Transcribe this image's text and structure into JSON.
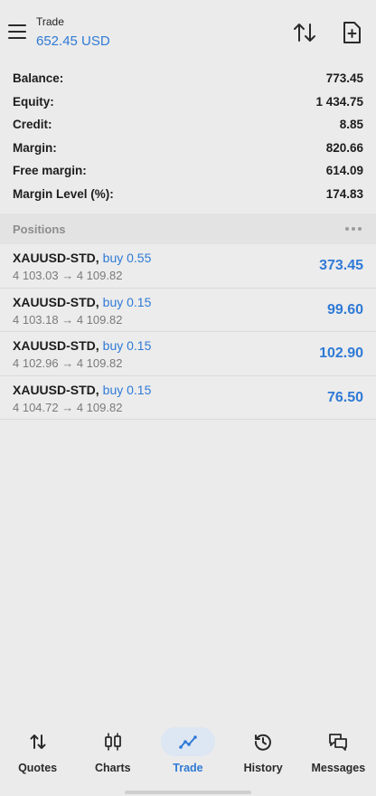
{
  "header": {
    "title": "Trade",
    "value": "652.45 USD"
  },
  "summary": [
    {
      "label": "Balance:",
      "value": "773.45"
    },
    {
      "label": "Equity:",
      "value": "1 434.75"
    },
    {
      "label": "Credit:",
      "value": "8.85"
    },
    {
      "label": "Margin:",
      "value": "820.66"
    },
    {
      "label": "Free margin:",
      "value": "614.09"
    },
    {
      "label": "Margin Level (%):",
      "value": "174.83"
    }
  ],
  "positions_section": {
    "title": "Positions"
  },
  "positions": [
    {
      "symbol": "XAUUSD-STD,",
      "side": "buy 0.55",
      "prices": "4 103.03 → 4 109.82",
      "profit": "373.45"
    },
    {
      "symbol": "XAUUSD-STD,",
      "side": "buy 0.15",
      "prices": "4 103.18 → 4 109.82",
      "profit": "99.60"
    },
    {
      "symbol": "XAUUSD-STD,",
      "side": "buy 0.15",
      "prices": "4 102.96 → 4 109.82",
      "profit": "102.90"
    },
    {
      "symbol": "XAUUSD-STD,",
      "side": "buy 0.15",
      "prices": "4 104.72 → 4 109.82",
      "profit": "76.50"
    }
  ],
  "nav": {
    "items": [
      {
        "label": "Quotes",
        "icon": "quotes-icon"
      },
      {
        "label": "Charts",
        "icon": "charts-icon"
      },
      {
        "label": "Trade",
        "icon": "trade-icon"
      },
      {
        "label": "History",
        "icon": "history-icon"
      },
      {
        "label": "Messages",
        "icon": "messages-icon"
      }
    ],
    "active": "Trade"
  },
  "colors": {
    "accent": "#2f7ad6",
    "background": "#ebebeb",
    "section_background": "#e3e3e3",
    "active_pill": "#dde6f3"
  }
}
